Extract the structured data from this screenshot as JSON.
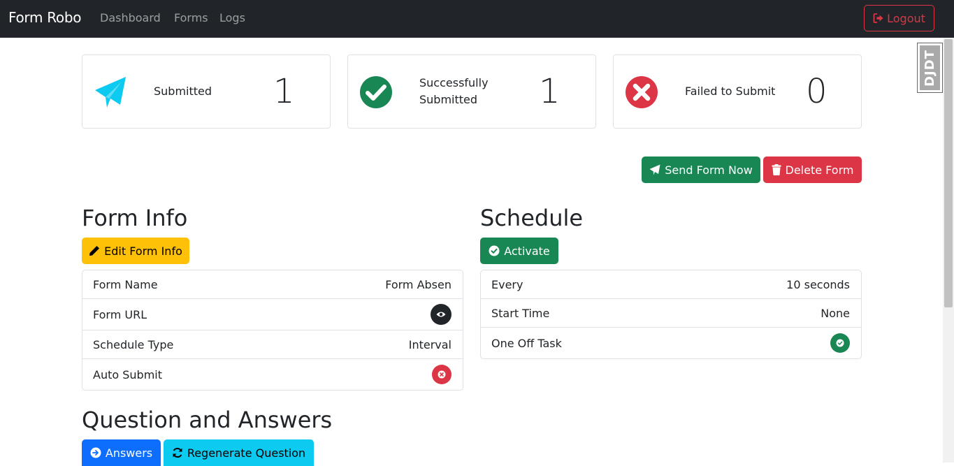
{
  "navbar": {
    "brand": "Form Robo",
    "links": [
      "Dashboard",
      "Forms",
      "Logs"
    ],
    "logout_label": "Logout"
  },
  "debug_toolbar": {
    "label": "DJDT"
  },
  "stats": [
    {
      "label": "Submitted",
      "value": "1",
      "icon": "paper-plane-icon",
      "color": "#0dcaf0"
    },
    {
      "label_line1": "Successfully",
      "label_line2": "Submitted",
      "value": "1",
      "icon": "check-circle-icon",
      "color": "#198754"
    },
    {
      "label": "Failed to Submit",
      "value": "0",
      "icon": "x-circle-icon",
      "color": "#dc3545"
    }
  ],
  "actions": {
    "send_label": "Send Form Now",
    "delete_label": "Delete Form"
  },
  "form_info": {
    "title": "Form Info",
    "edit_label": "Edit Form Info",
    "rows": [
      {
        "label": "Form Name",
        "value": "Form Absen"
      },
      {
        "label": "Form URL",
        "value_icon": "eye-icon"
      },
      {
        "label": "Schedule Type",
        "value": "Interval"
      },
      {
        "label": "Auto Submit",
        "value_icon": "x-circle-icon"
      }
    ]
  },
  "schedule": {
    "title": "Schedule",
    "activate_label": "Activate",
    "rows": [
      {
        "label": "Every",
        "value": "10 seconds"
      },
      {
        "label": "Start Time",
        "value": "None"
      },
      {
        "label": "One Off Task",
        "value_icon": "check-circle-icon"
      }
    ]
  },
  "qa": {
    "title": "Question and Answers",
    "answers_label": "Answers",
    "regenerate_label": "Regenerate Question"
  },
  "colors": {
    "navbar": "#212529",
    "success": "#198754",
    "danger": "#dc3545",
    "warning": "#ffc107",
    "primary": "#0d6efd",
    "info": "#0dcaf0"
  }
}
